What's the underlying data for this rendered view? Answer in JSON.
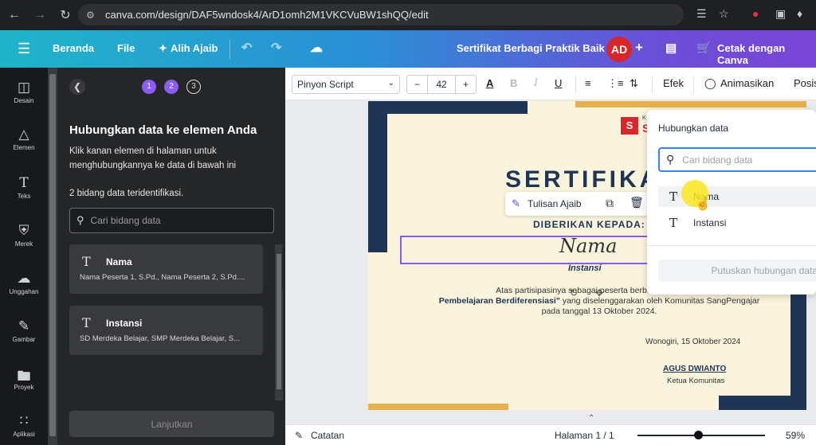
{
  "browser": {
    "url": "canva.com/design/DAF5wndosk4/ArD1omh2M1VKCVuBW1shQQ/edit"
  },
  "header": {
    "home": "Beranda",
    "file": "File",
    "magic": "Alih Ajaib",
    "doc_title": "Sertifikat Berbagi Praktik Baik",
    "avatar": "AD",
    "print": "Cetak dengan Canva"
  },
  "rail": [
    {
      "label": "Desain",
      "icon": "layout-icon"
    },
    {
      "label": "Elemen",
      "icon": "shapes-icon"
    },
    {
      "label": "Teks",
      "icon": "text-icon"
    },
    {
      "label": "Merek",
      "icon": "brand-icon"
    },
    {
      "label": "Unggahan",
      "icon": "upload-icon"
    },
    {
      "label": "Gambar",
      "icon": "draw-icon"
    },
    {
      "label": "Proyek",
      "icon": "folder-icon"
    },
    {
      "label": "Aplikasi",
      "icon": "apps-icon"
    }
  ],
  "panel": {
    "steps": [
      "1",
      "2",
      "3"
    ],
    "title": "Hubungkan data ke elemen Anda",
    "desc": "Klik kanan elemen di halaman untuk menghubungkannya ke data di bawah ini",
    "count": "2 bidang data teridentifikasi.",
    "search_placeholder": "Cari bidang data",
    "fields": [
      {
        "name": "Nama",
        "values": "Nama Peserta 1, S.Pd., Nama Peserta 2, S.Pd...."
      },
      {
        "name": "Instansi",
        "values": "SD Merdeka Belajar, SMP Merdeka Belajar, S..."
      }
    ],
    "next": "Lanjutkan"
  },
  "toolbar": {
    "font": "Pinyon Script",
    "size": "42",
    "minus": "−",
    "plus": "+",
    "effects": "Efek",
    "animate": "Animasikan",
    "position": "Posisi"
  },
  "certificate": {
    "logo_letter": "S",
    "logo_text": "S",
    "logo_small": "K",
    "title": "SERTIFIKA",
    "given_to": "DIBERIKAN KEPADA:",
    "name": "Nama",
    "institution": "Instansi",
    "body_line1": "Atas partisipasinya sebagai peserta berbagi praktik baik",
    "body_line2_bold": "Pembelajaran Berdiferensiasi\"",
    "body_line2_rest": " yang diselenggarakan oleh Komunitas SangPengajar",
    "body_line3": "pada tanggal 13 Oktober 2024.",
    "place_date": "Wonogiri, 15 Oktober 2024",
    "signer": "AGUS DWIANTO",
    "signer_role": "Ketua Komunitas"
  },
  "float_toolbar": {
    "magic_write": "Tulisan Ajaib"
  },
  "popup": {
    "title": "Hubungkan data",
    "search_placeholder": "Cari bidang data",
    "options": [
      "Nama",
      "Instansi"
    ],
    "disconnect": "Putuskan hubungan data"
  },
  "bottom": {
    "notes": "Catatan",
    "page": "Halaman 1 / 1",
    "zoom": "59%"
  },
  "colors": {
    "accent": "#8b5cf6",
    "cert_navy": "#1f3556",
    "cert_gold": "#e7b04a",
    "avatar": "#d9262b"
  }
}
